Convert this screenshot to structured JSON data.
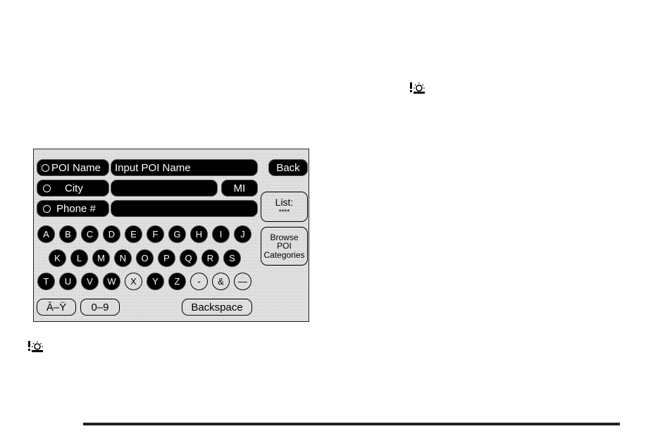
{
  "screen": {
    "search_fields": [
      {
        "label": "POI Name",
        "value": "Input POI Name"
      },
      {
        "label": "City",
        "value": "",
        "state_button": "MI"
      },
      {
        "label": "Phone #",
        "value": ""
      }
    ],
    "back_label": "Back",
    "list_label": "List:",
    "list_count": "****",
    "browse_label_lines": [
      "Browse",
      "POI",
      "Categories"
    ],
    "keyboard": {
      "row1": [
        "A",
        "B",
        "C",
        "D",
        "E",
        "F",
        "G",
        "H",
        "I",
        "J"
      ],
      "row2": [
        "K",
        "L",
        "M",
        "N",
        "O",
        "P",
        "Q",
        "R",
        "S"
      ],
      "row3": [
        {
          "key": "T",
          "enabled": true
        },
        {
          "key": "U",
          "enabled": true
        },
        {
          "key": "V",
          "enabled": true
        },
        {
          "key": "W",
          "enabled": true
        },
        {
          "key": "X",
          "enabled": false
        },
        {
          "key": "Y",
          "enabled": true
        },
        {
          "key": "Z",
          "enabled": true
        },
        {
          "key": "-",
          "enabled": false
        },
        {
          "key": "&",
          "enabled": false
        },
        {
          "key": "—",
          "enabled": false
        }
      ]
    },
    "accent_label": "Ā–Ÿ",
    "numbers_label": "0–9",
    "backspace_label": "Backspace"
  },
  "icons": {
    "caution_icon_1": "caution-icon",
    "caution_icon_2": "caution-icon"
  },
  "colors": {
    "key_active": "#000000",
    "panel_bg": "#e6e6e6",
    "text_on_dark": "#ffffff"
  }
}
